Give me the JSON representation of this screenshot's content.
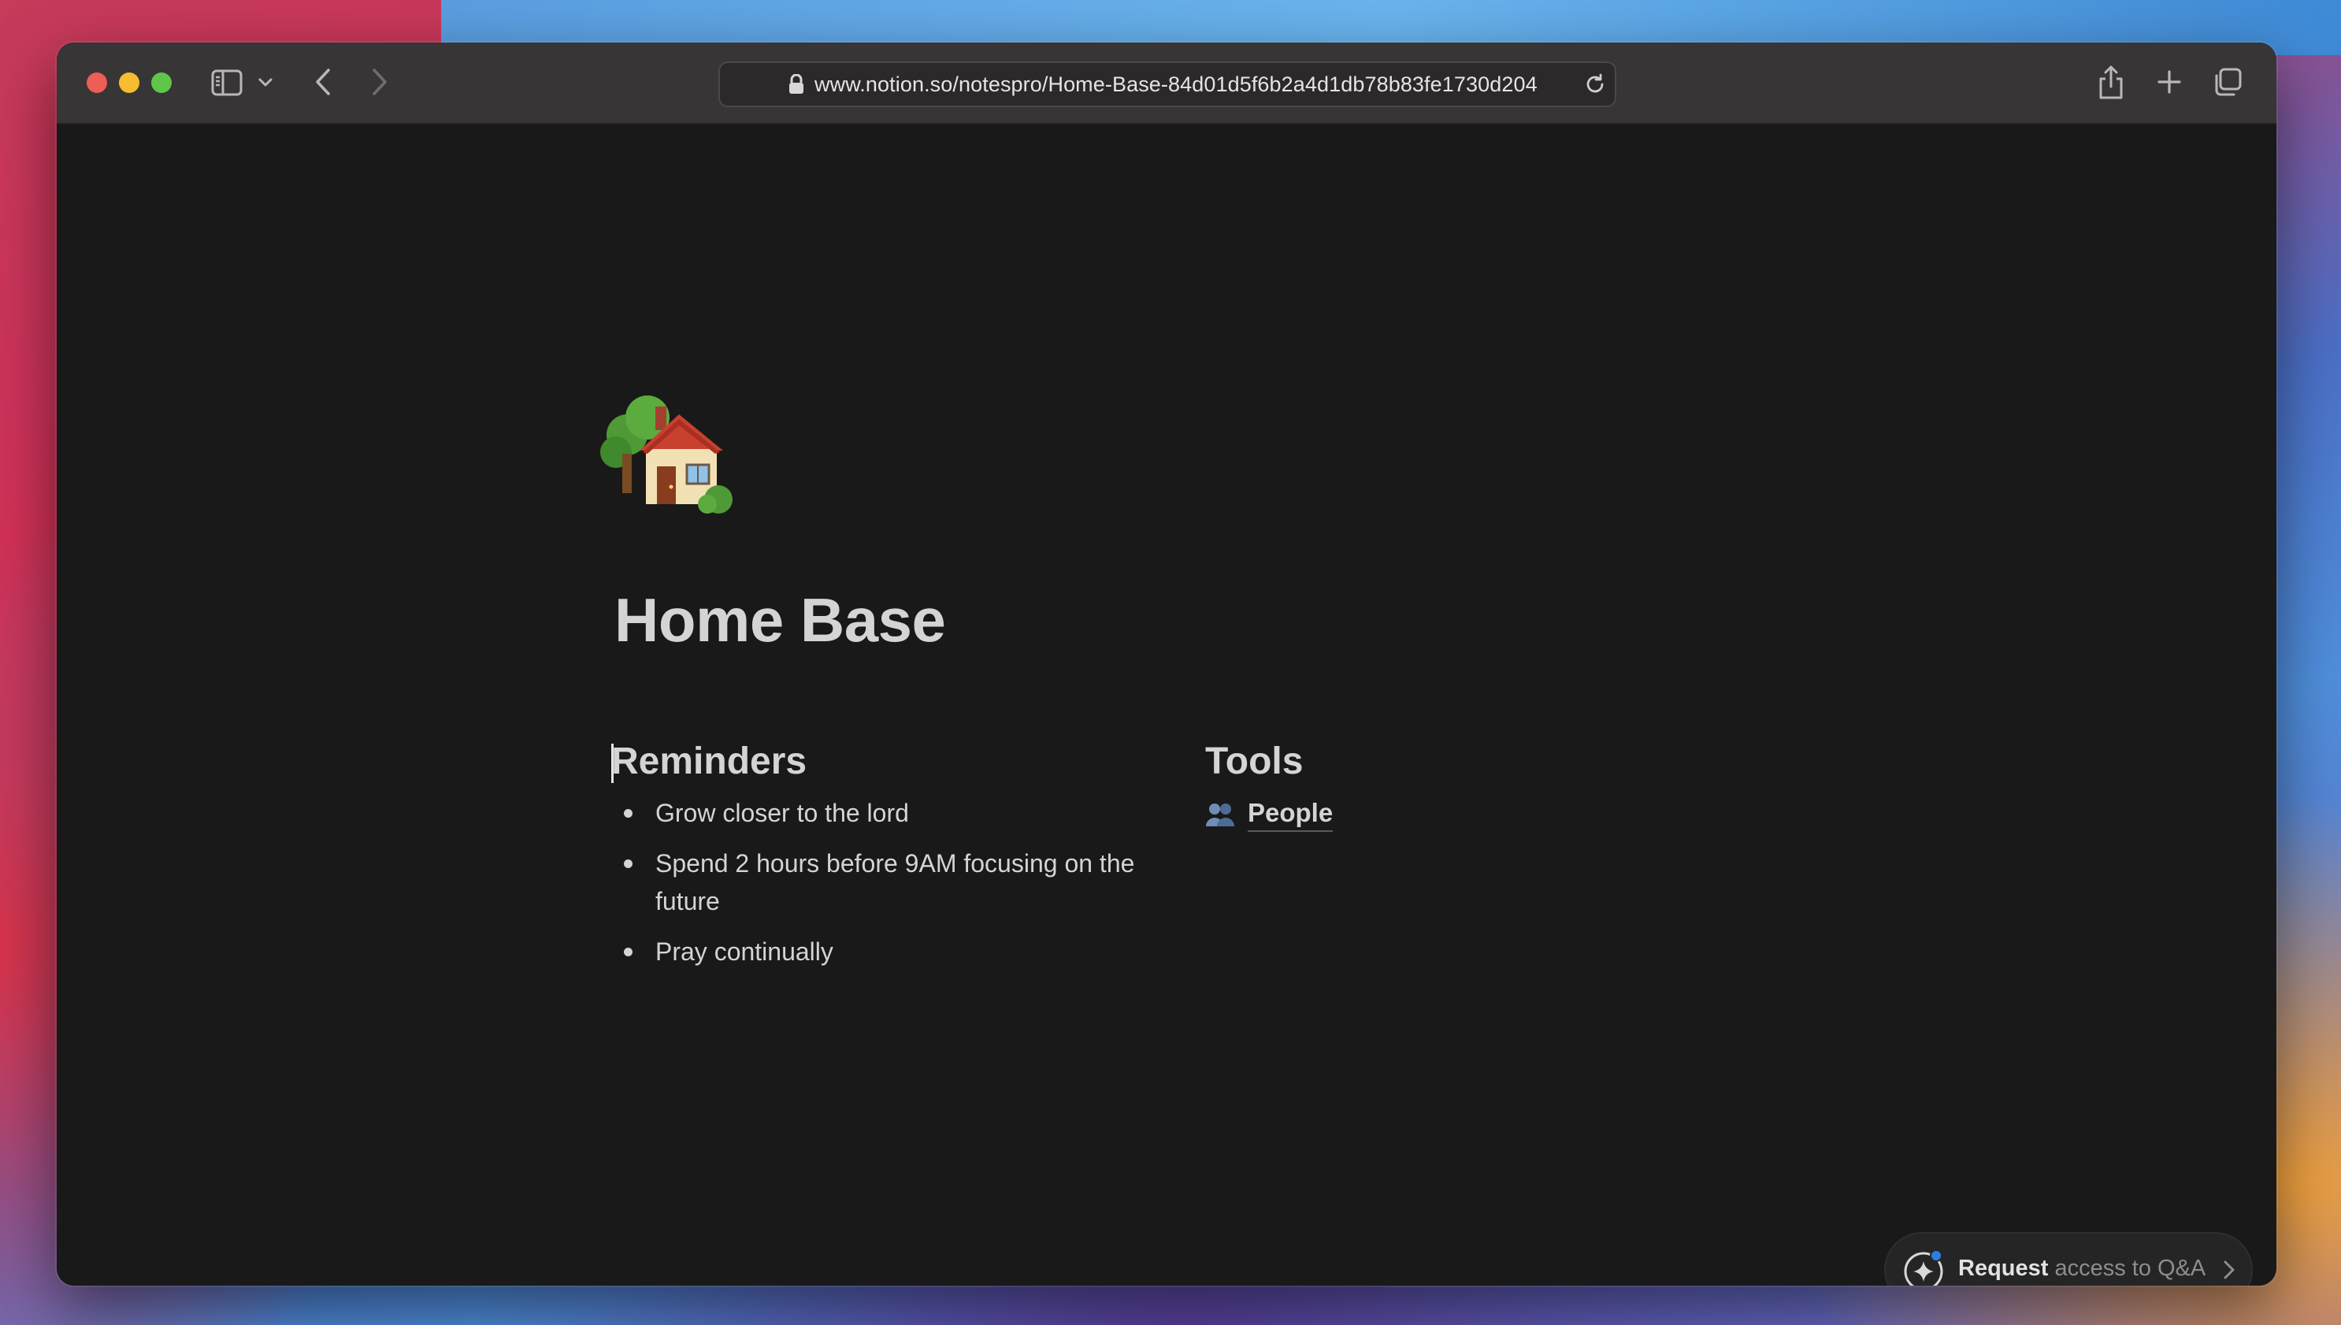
{
  "browser": {
    "url": "www.notion.so/notespro/Home-Base-84d01d5f6b2a4d1db78b83fe1730d204",
    "icons": [
      "sidebar-icon",
      "chevron-down-icon",
      "back-icon",
      "forward-icon",
      "lock-icon",
      "reload-icon",
      "share-icon",
      "new-tab-icon",
      "tabs-overview-icon"
    ]
  },
  "page": {
    "emoji": "house-with-garden-icon",
    "title": "Home Base"
  },
  "reminders": {
    "heading": "Reminders",
    "items": [
      "Grow closer to the lord",
      "Spend 2 hours before 9AM focusing on the future",
      "Pray continually"
    ]
  },
  "tools": {
    "heading": "Tools",
    "links": [
      {
        "icon": "people-icon",
        "label": "People"
      }
    ]
  },
  "qa_banner": {
    "action": "Request",
    "rest": " access to Q&A"
  },
  "colors": {
    "page_bg": "#191919",
    "toolbar_bg": "#373536",
    "text": "#d4d4d4",
    "accent_dot": "#2e7de6"
  }
}
